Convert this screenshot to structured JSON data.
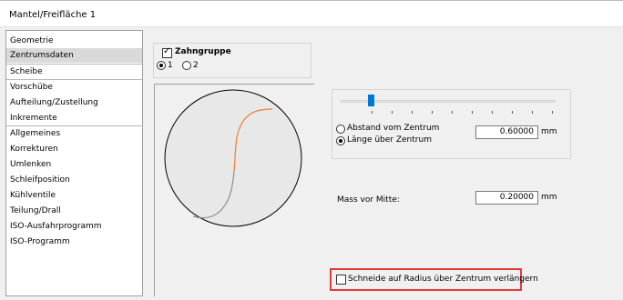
{
  "window": {
    "title": "Mantel/Freifläche 1"
  },
  "sidebar": {
    "items": [
      {
        "label": "Geometrie",
        "selected": false
      },
      {
        "label": "Zentrumsdaten",
        "selected": true
      },
      {
        "label": "Scheibe",
        "selected": false
      },
      {
        "label": "Vorschübe",
        "selected": false
      },
      {
        "label": "Aufteilung/Zustellung",
        "selected": false
      },
      {
        "label": "Inkremente",
        "selected": false
      },
      {
        "label": "Allgemeines",
        "selected": false
      },
      {
        "label": "Korrekturen",
        "selected": false
      },
      {
        "label": "Umlenken",
        "selected": false
      },
      {
        "label": "Schleifposition",
        "selected": false
      },
      {
        "label": "Kühlventile",
        "selected": false
      },
      {
        "label": "Teilung/Drall",
        "selected": false
      },
      {
        "label": "ISO-Ausfahrprogramm",
        "selected": false
      },
      {
        "label": "ISO-Programm",
        "selected": false
      }
    ]
  },
  "zahngruppe": {
    "label": "Zahngruppe",
    "checked": true,
    "options": [
      {
        "label": "1",
        "selected": true
      },
      {
        "label": "2",
        "selected": false
      }
    ]
  },
  "preview": {
    "arc_color": "#f07c30",
    "arc_gray": "#8c8c8c"
  },
  "slider": {
    "level": 0.13
  },
  "position": {
    "options": [
      {
        "label": "Abstand vom Zentrum",
        "selected": false
      },
      {
        "label": "Länge über Zentrum",
        "selected": true
      }
    ],
    "value": "0.60000",
    "unit": "mm"
  },
  "mass": {
    "label": "Mass vor Mitte:",
    "value": "0.20000",
    "unit": "mm"
  },
  "extend": {
    "label": "Schneide auf Radius über Zentrum verlängern",
    "checked": false
  },
  "colors": {
    "highlight": "#e03c3c",
    "slider": "#0078d7"
  }
}
